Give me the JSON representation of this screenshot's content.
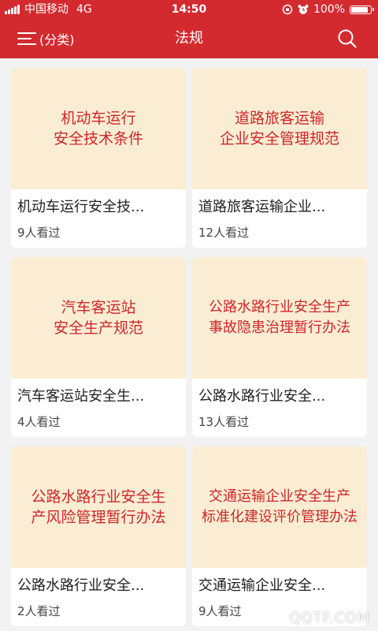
{
  "status_bar": {
    "carrier": "中国移动",
    "network": "4G",
    "time": "14:50",
    "battery": "100%"
  },
  "navbar": {
    "menu_label": "(分类)",
    "title": "法规"
  },
  "cards": [
    {
      "cover_lines": [
        "机动车运行",
        "安全技术条件"
      ],
      "title": "机动车运行安全技...",
      "views": "9人看过"
    },
    {
      "cover_lines": [
        "道路旅客运输",
        "企业安全管理规范"
      ],
      "title": "道路旅客运输企业...",
      "views": "12人看过"
    },
    {
      "cover_lines": [
        "汽车客运站",
        "安全生产规范"
      ],
      "title": "汽车客运站安全生...",
      "views": "4人看过"
    },
    {
      "cover_lines": [
        "公路水路行业安全生产",
        "事故隐患治理暂行办法"
      ],
      "title": "公路水路行业安全...",
      "views": "13人看过"
    },
    {
      "cover_lines": [
        "公路水路行业安全生",
        "产风险管理暂行办法"
      ],
      "title": "公路水路行业安全...",
      "views": "2人看过"
    },
    {
      "cover_lines": [
        "交通运输企业安全生产",
        "标准化建设评价管理办法"
      ],
      "title": "交通运输企业安全...",
      "views": "9人看过"
    }
  ],
  "watermark": "QQTF.COM",
  "colors": {
    "header": "#d32a2f",
    "cover_bg": "#faedd3",
    "cover_text": "#d0262b"
  }
}
